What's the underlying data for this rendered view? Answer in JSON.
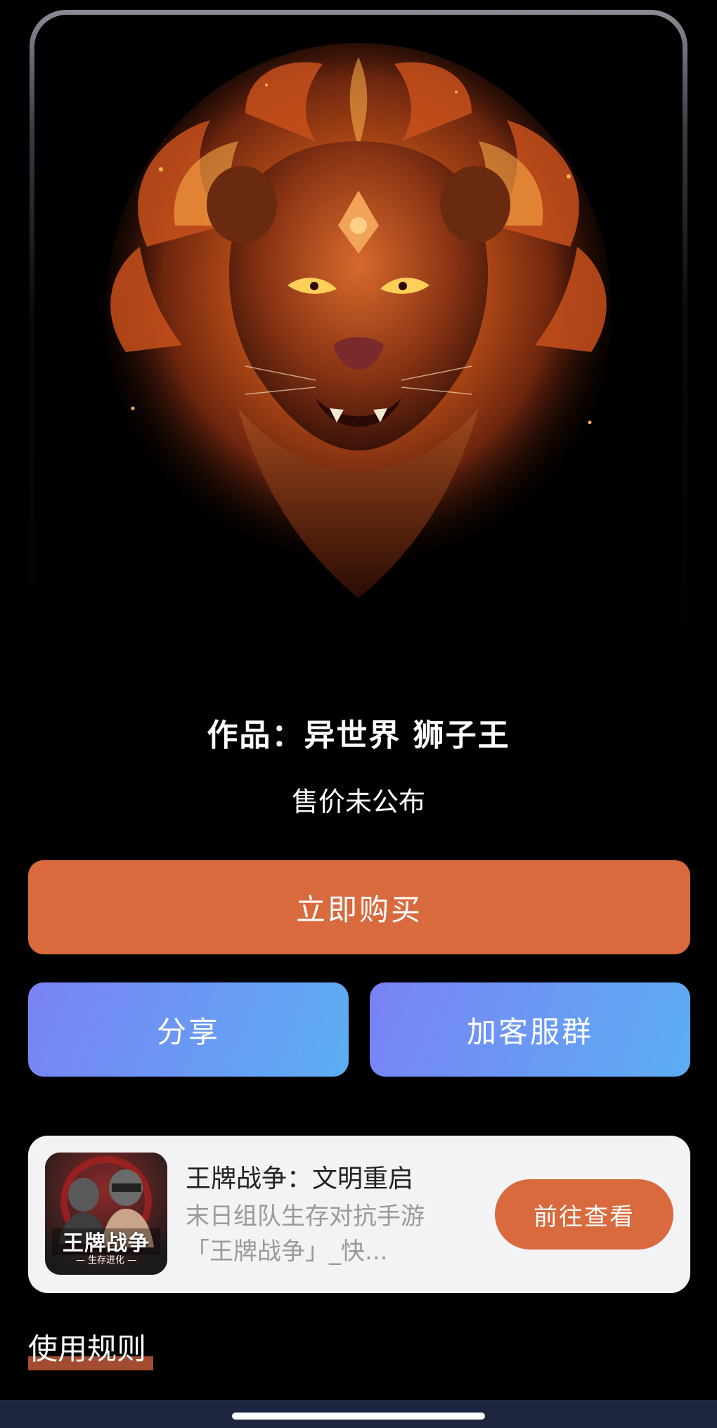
{
  "artwork": {
    "icon": "lion-artwork-image"
  },
  "product": {
    "title": "作品：异世界 狮子王",
    "price_status": "售价未公布"
  },
  "actions": {
    "buy_label": "立即购买",
    "share_label": "分享",
    "group_label": "加客服群"
  },
  "promo": {
    "title": "王牌战争：文明重启",
    "description": "末日组队生存对抗手游「王牌战争」_快...",
    "button_label": "前往查看",
    "thumb_logo_text": "王牌战争",
    "thumb_logo_sub": "— 生存进化 —"
  },
  "rules": {
    "label": "使用规则"
  },
  "colors": {
    "accent_orange": "#d86a3e",
    "button_gradient_start": "#7a82f4",
    "button_gradient_end": "#5caef3",
    "card_bg": "#f3f3f5"
  }
}
